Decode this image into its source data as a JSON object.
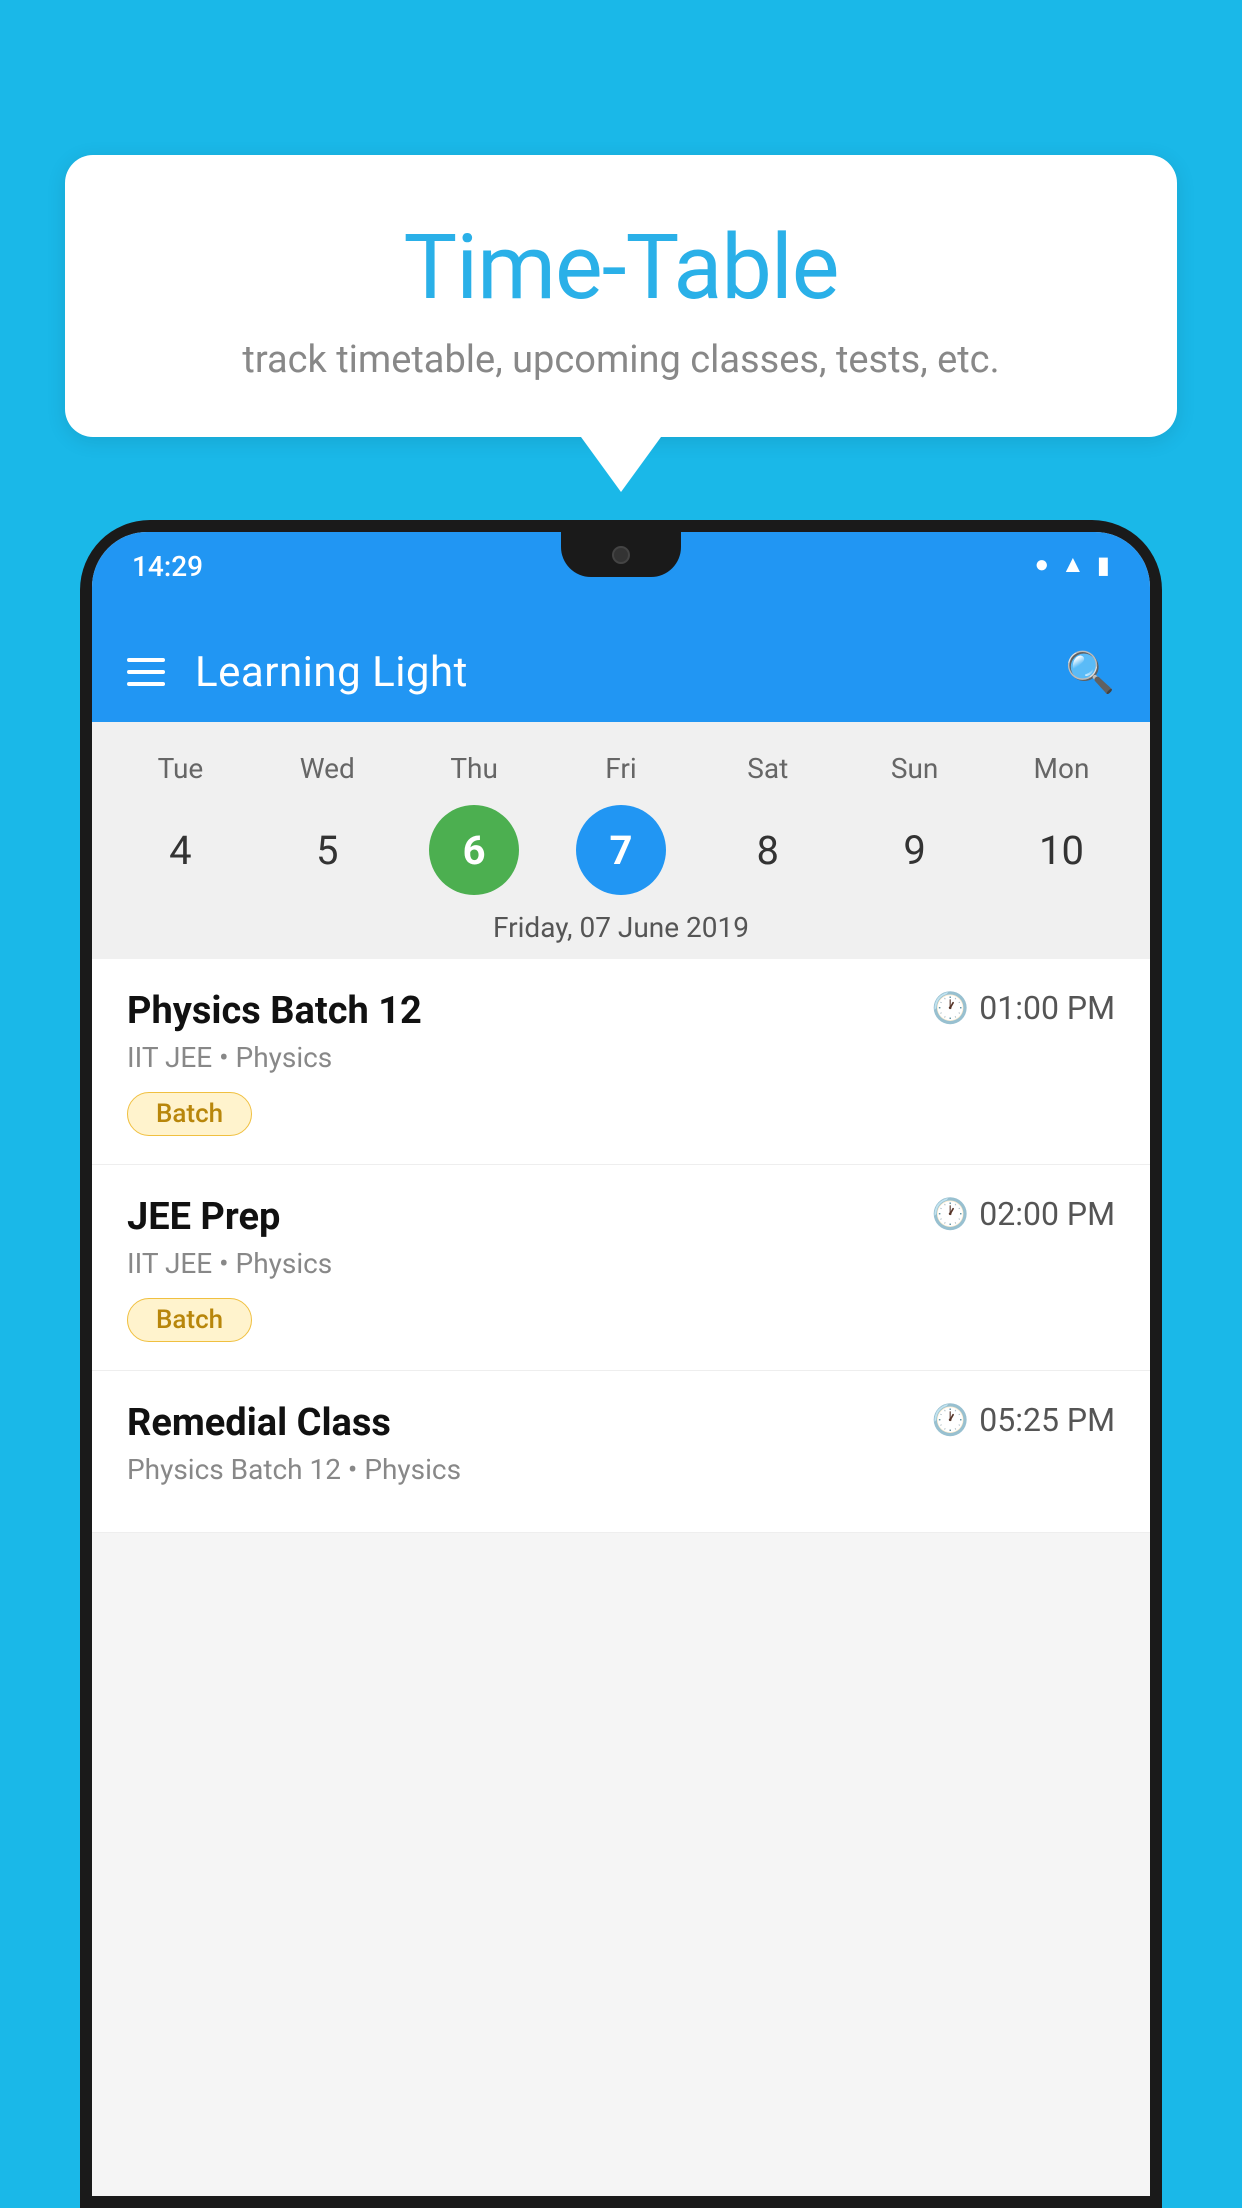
{
  "background": {
    "color": "#1ab8e8"
  },
  "speech_bubble": {
    "title": "Time-Table",
    "subtitle": "track timetable, upcoming classes, tests, etc."
  },
  "phone": {
    "status_bar": {
      "time": "14:29",
      "icons": [
        "wifi",
        "signal",
        "battery"
      ]
    },
    "header": {
      "title": "Learning Light",
      "menu_label": "menu",
      "search_label": "search"
    },
    "calendar": {
      "days": [
        "Tue",
        "Wed",
        "Thu",
        "Fri",
        "Sat",
        "Sun",
        "Mon"
      ],
      "dates": [
        {
          "date": "4",
          "state": "normal"
        },
        {
          "date": "5",
          "state": "normal"
        },
        {
          "date": "6",
          "state": "today"
        },
        {
          "date": "7",
          "state": "selected"
        },
        {
          "date": "8",
          "state": "normal"
        },
        {
          "date": "9",
          "state": "normal"
        },
        {
          "date": "10",
          "state": "normal"
        }
      ],
      "selected_date_label": "Friday, 07 June 2019"
    },
    "schedule": [
      {
        "title": "Physics Batch 12",
        "time": "01:00 PM",
        "subtitle": "IIT JEE • Physics",
        "badge": "Batch"
      },
      {
        "title": "JEE Prep",
        "time": "02:00 PM",
        "subtitle": "IIT JEE • Physics",
        "badge": "Batch"
      },
      {
        "title": "Remedial Class",
        "time": "05:25 PM",
        "subtitle": "Physics Batch 12 • Physics",
        "badge": ""
      }
    ]
  }
}
